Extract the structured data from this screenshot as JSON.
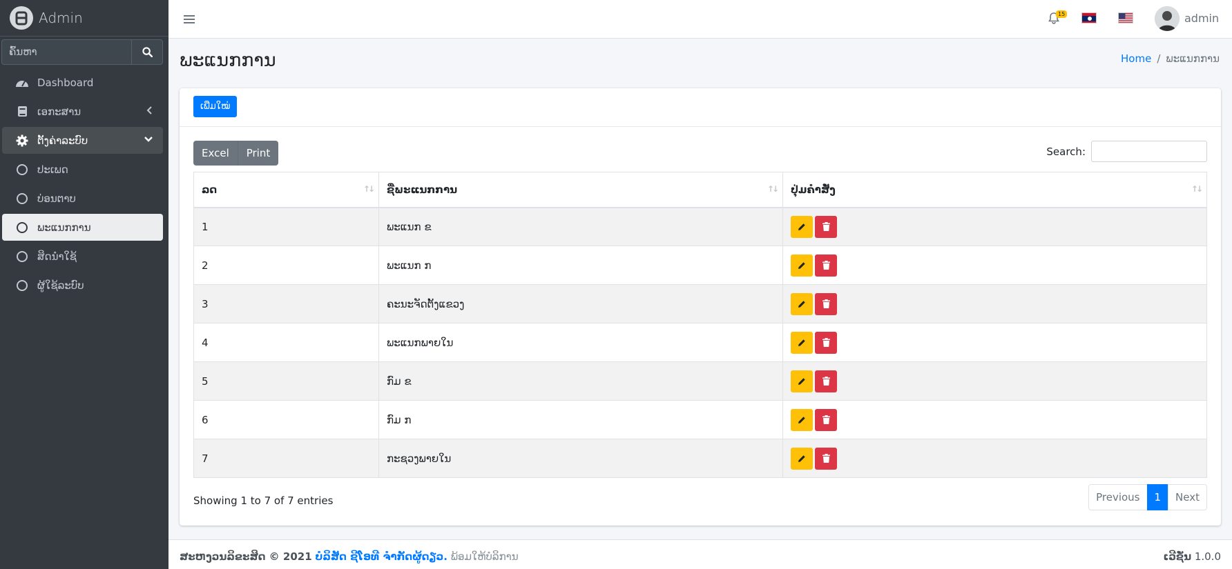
{
  "brand": {
    "title": "Admin"
  },
  "sidebar": {
    "search_placeholder": "ຄົ້ນຫາ",
    "items": [
      {
        "label": "Dashboard",
        "icon": "dashboard-icon"
      },
      {
        "label": "ເອກະສານ",
        "icon": "book-icon"
      },
      {
        "label": "ຕັ້ງຄ່າລະບົບ",
        "icon": "gear-icon"
      },
      {
        "label": "ປະເພດ",
        "icon": "circle-icon"
      },
      {
        "label": "ບ່ອນຕາບ",
        "icon": "circle-icon"
      },
      {
        "label": "ພະແນກການ",
        "icon": "circle-icon"
      },
      {
        "label": "ສິດນຳໃຊ້",
        "icon": "circle-icon"
      },
      {
        "label": "ຜູ້ໃຊ້ລະບົບ",
        "icon": "circle-icon"
      }
    ]
  },
  "topbar": {
    "notification_count": "15",
    "username": "admin"
  },
  "header": {
    "title": "ພະແນກການ",
    "breadcrumb_home": "Home",
    "breadcrumb_sep": "/",
    "breadcrumb_current": "ພະແນກການ"
  },
  "card": {
    "add_label": "ເພີ່ມໃໝ່",
    "excel_label": "Excel",
    "print_label": "Print",
    "search_label": "Search:",
    "columns": [
      "ລດ",
      "ຊື່ພະແນກການ",
      "ປຸ່ມຄຳສັ່ງ"
    ],
    "rows": [
      {
        "no": "1",
        "name": "ພະແນກ ຂ"
      },
      {
        "no": "2",
        "name": "ພະແນກ ກ"
      },
      {
        "no": "3",
        "name": "ຄະນະຈັດຕັ້ງແຂວງ"
      },
      {
        "no": "4",
        "name": "ພະແນກພາຍໃນ"
      },
      {
        "no": "5",
        "name": "ກົມ ຂ"
      },
      {
        "no": "6",
        "name": "ກົມ ກ"
      },
      {
        "no": "7",
        "name": "ກະຊວງພາຍໃນ"
      }
    ],
    "info": "Showing 1 to 7 of 7 entries",
    "pager": {
      "prev": "Previous",
      "current": "1",
      "next": "Next"
    }
  },
  "footer": {
    "copyright": "ສະຫງວນລິຂະສິດ © 2021",
    "company": "ບໍລິສັດ ຊີໂອທີ ຈຳກັດຜູ້ດຽວ.",
    "suffix": "ພ້ອມໃຫ້ບໍລິການ",
    "version_label": "ເວີຊັ່ນ",
    "version": "1.0.0"
  },
  "colors": {
    "primary": "#007bff",
    "warning": "#ffc107",
    "danger": "#dc3545",
    "sidebar": "#343a40"
  }
}
